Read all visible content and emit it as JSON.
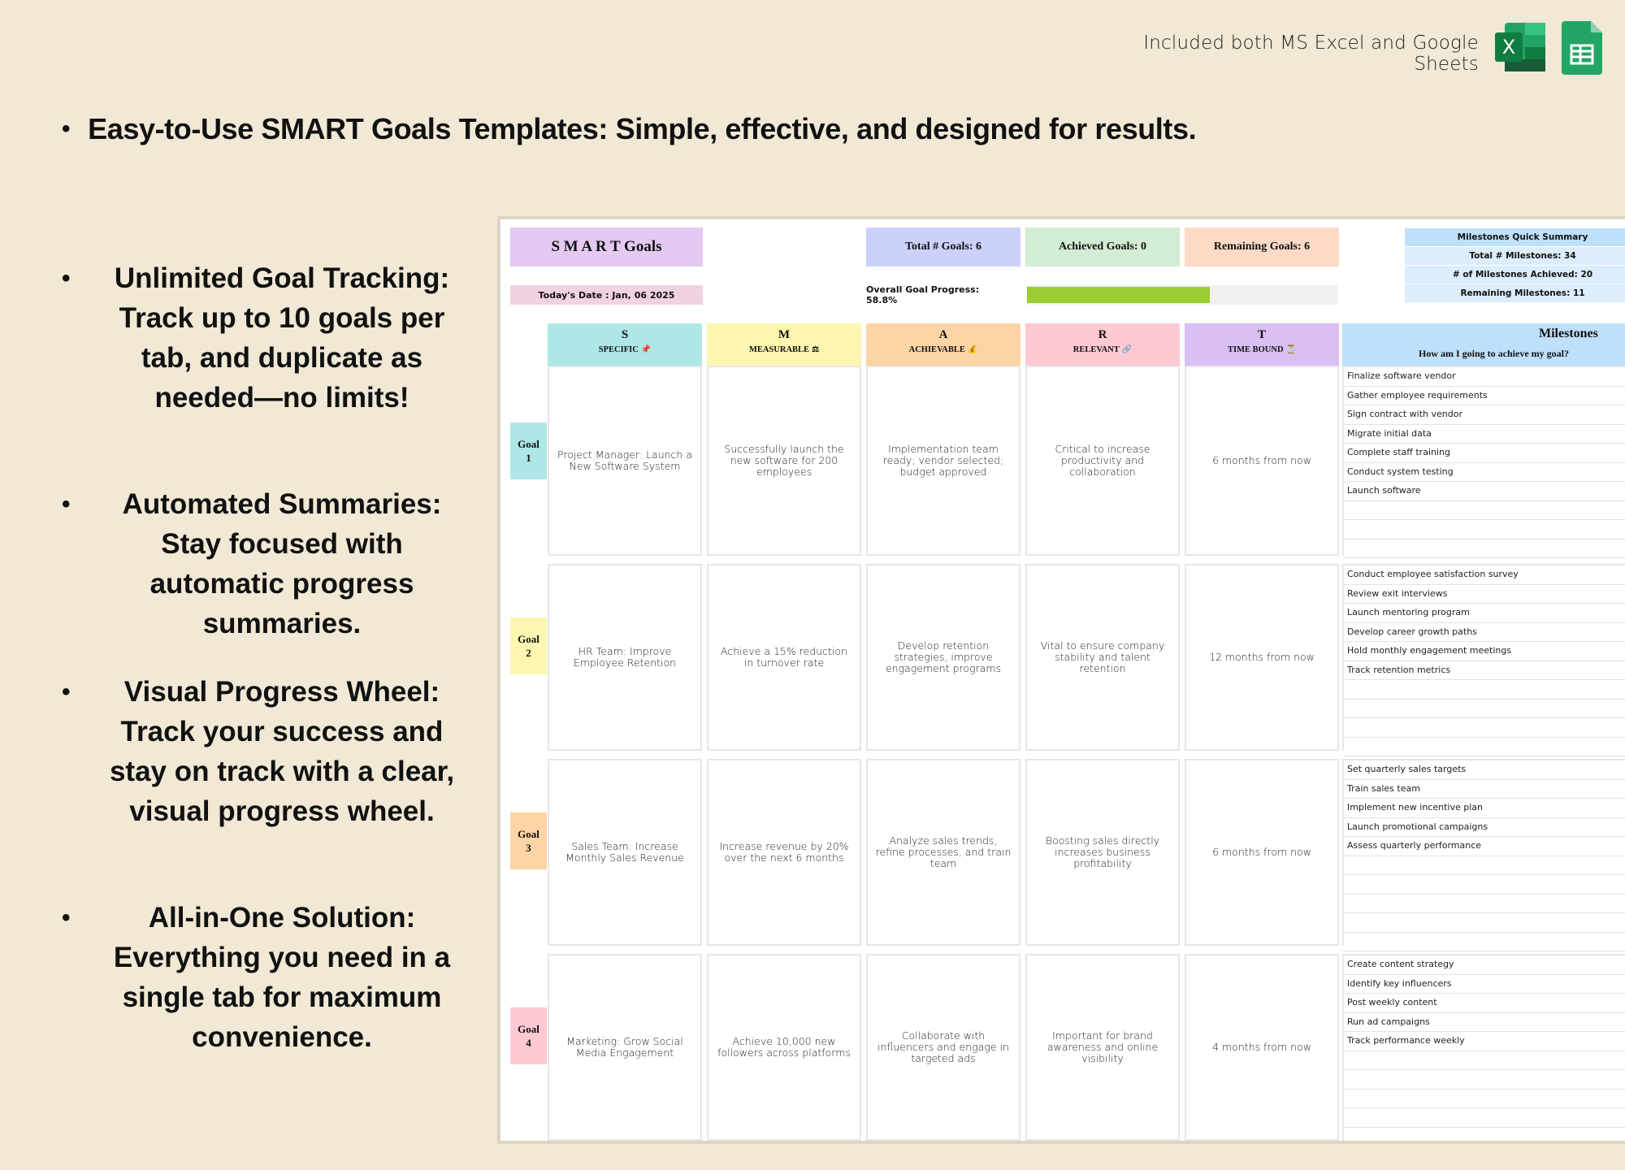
{
  "top_note": "Included both MS Excel and Google Sheets",
  "icons": {
    "excel": "excel-icon",
    "sheets": "google-sheets-icon"
  },
  "headline": "Easy-to-Use SMART Goals Templates: Simple, effective, and designed for results.",
  "features": [
    "Unlimited Goal Tracking: Track up to 10 goals per tab, and duplicate as needed—no limits!",
    "Automated Summaries: Stay focused with automatic progress summaries.",
    "Visual Progress Wheel: Track your success and stay on track with a clear, visual progress wheel.",
    "All-in-One Solution: Everything you need in a single tab for maximum convenience."
  ],
  "sheet": {
    "title": "S M A R T Goals",
    "today": "Today's Date : Jan, 06 2025",
    "total_goals": "Total # Goals: 6",
    "achieved_goals": "Achieved Goals: 0",
    "remaining_goals": "Remaining Goals: 6",
    "overall_progress_label": "Overall Goal Progress: 58.8%",
    "overall_progress_value": 0.588,
    "milestones_summary": {
      "title": "Milestones Quick Summary",
      "total": "Total # Milestones: 34",
      "achieved": "# of Milestones Achieved: 20",
      "remaining": "Remaining Milestones: 11"
    },
    "columns": [
      {
        "letter": "S",
        "word": "SPECIFIC",
        "icon": "📌",
        "color": "#ade7e6"
      },
      {
        "letter": "M",
        "word": "MEASURABLE",
        "icon": "⚖",
        "color": "#fdf6b0"
      },
      {
        "letter": "A",
        "word": "ACHIEVABLE",
        "icon": "💰",
        "color": "#fdd4a6"
      },
      {
        "letter": "R",
        "word": "RELEVANT",
        "icon": "🔗",
        "color": "#fdc9d3"
      },
      {
        "letter": "T",
        "word": "TIME BOUND",
        "icon": "⏳",
        "color": "#d9bff4"
      }
    ],
    "milestones_header": {
      "title": "Milestones",
      "subtitle": "How am I going to achieve my goal?"
    },
    "goals": [
      {
        "label": "Goal",
        "number": "1",
        "color": "#ade7e6",
        "specific": "Project Manager: Launch a New Software System",
        "measurable": "Successfully launch the new software for 200 employees",
        "achievable": "Implementation team ready; vendor selected; budget approved",
        "relevant": "Critical to increase productivity and collaboration",
        "time_bound": "6 months from now",
        "milestones": [
          "Finalize software vendor",
          "Gather employee requirements",
          "Sign contract with vendor",
          "Migrate initial data",
          "Complete staff training",
          "Conduct system testing",
          "Launch software",
          "",
          "",
          ""
        ]
      },
      {
        "label": "Goal",
        "number": "2",
        "color": "#fdf6b0",
        "specific": "HR Team: Improve Employee Retention",
        "measurable": "Achieve a 15% reduction in turnover rate",
        "achievable": "Develop retention strategies, improve engagement programs",
        "relevant": "Vital to ensure company stability and talent retention",
        "time_bound": "12 months from now",
        "milestones": [
          "Conduct employee satisfaction survey",
          "Review exit interviews",
          "Launch mentoring program",
          "Develop career growth paths",
          "Hold monthly engagement meetings",
          "Track retention metrics",
          "",
          "",
          "",
          ""
        ]
      },
      {
        "label": "Goal",
        "number": "3",
        "color": "#fdd4a6",
        "specific": "Sales Team: Increase Monthly Sales Revenue",
        "measurable": "Increase revenue by 20% over the next 6 months",
        "achievable": "Analyze sales trends, refine processes, and train team",
        "relevant": "Boosting sales directly increases business profitability",
        "time_bound": "6 months from now",
        "milestones": [
          "Set quarterly sales targets",
          "Train sales team",
          "Implement new incentive plan",
          "Launch promotional campaigns",
          "Assess quarterly performance",
          "",
          "",
          "",
          "",
          ""
        ]
      },
      {
        "label": "Goal",
        "number": "4",
        "color": "#fdc9d3",
        "specific": "Marketing: Grow Social Media Engagement",
        "measurable": "Achieve 10,000 new followers across platforms",
        "achievable": "Collaborate with influencers and engage in targeted ads",
        "relevant": "Important for brand awareness and online visibility",
        "time_bound": "4 months from now",
        "milestones": [
          "Create content strategy",
          "Identify key influencers",
          "Post weekly content",
          "Run ad campaigns",
          "Track performance weekly",
          "",
          "",
          "",
          "",
          ""
        ]
      }
    ]
  }
}
